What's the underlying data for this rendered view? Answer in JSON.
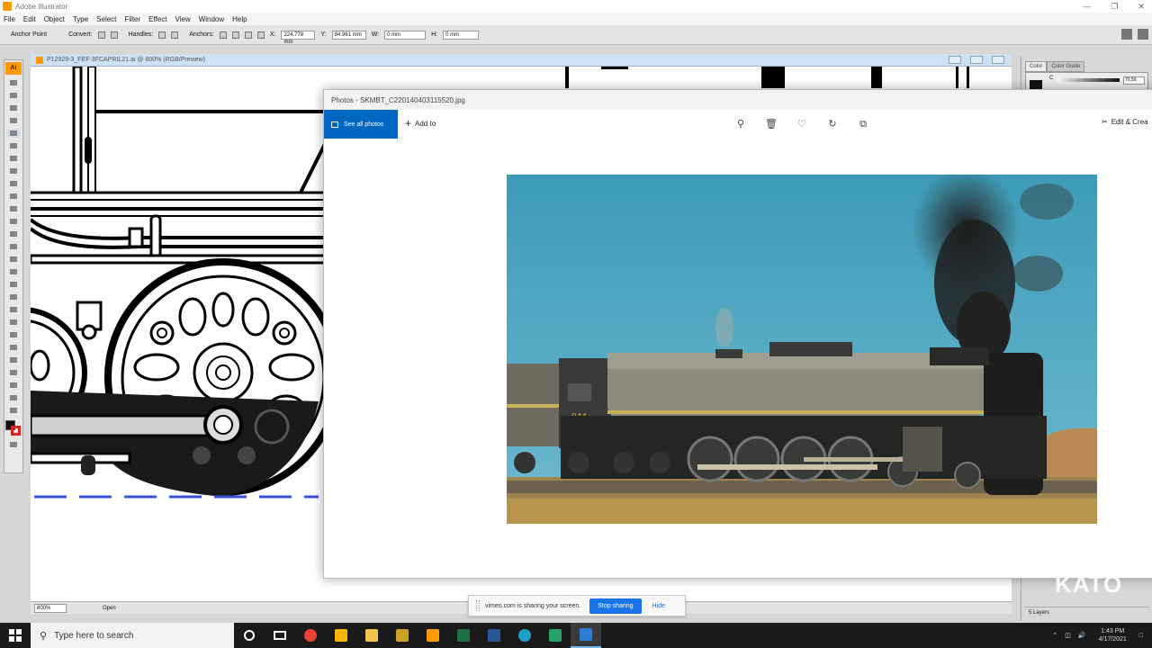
{
  "illustrator": {
    "app_title": "Adobe Illustrator",
    "menu": [
      "File",
      "Edit",
      "Object",
      "Type",
      "Select",
      "Filter",
      "Effect",
      "View",
      "Window",
      "Help"
    ],
    "control_bar": {
      "tool_label": "Anchor Point",
      "convert_label": "Convert:",
      "handles_label": "Handles:",
      "anchors_label": "Anchors:",
      "x_label": "X:",
      "x_value": "224.778 mm",
      "y_label": "Y:",
      "y_value": "84.961 mm",
      "w_label": "W:",
      "w_value": "0 mm",
      "h_label": "H:",
      "h_value": "0 mm"
    },
    "toolbox_badge": "Ai",
    "document_tab": "P12929-3_FEF-3FCAPRIL21.ai @ 800% (RGB/Preview)",
    "status": {
      "zoom": "800%",
      "mode": "Open"
    },
    "color_panel": {
      "tab_color": "Color",
      "tab_guide": "Color Guide",
      "channel_label": "C",
      "channel_value": "70.59",
      "swatch_color": "#111111"
    },
    "layers_count": "5 Layers"
  },
  "photos_app": {
    "title": "Photos - SKMBT_C220140403115520.jpg",
    "see_all_label": "See all photos",
    "add_to_label": "Add to",
    "edit_label": "Edit & Crea",
    "toolbar_icons": [
      "zoom-icon",
      "delete-icon",
      "favorite-icon",
      "rotate-icon",
      "crop-icon"
    ],
    "image_caption": "Steam locomotive photograph"
  },
  "share_banner": {
    "message": "vimeo.com is sharing your screen.",
    "stop_label": "Stop sharing",
    "hide_label": "Hide"
  },
  "watermark": "KATO",
  "taskbar": {
    "search_placeholder": "Type here to search",
    "time": "1:43 PM",
    "date": "4/17/2021",
    "accent": "#76b9ed"
  },
  "colors": {
    "ai_orange": "#ff9a00",
    "photos_blue": "#0067c0",
    "share_blue": "#1a73e8"
  }
}
